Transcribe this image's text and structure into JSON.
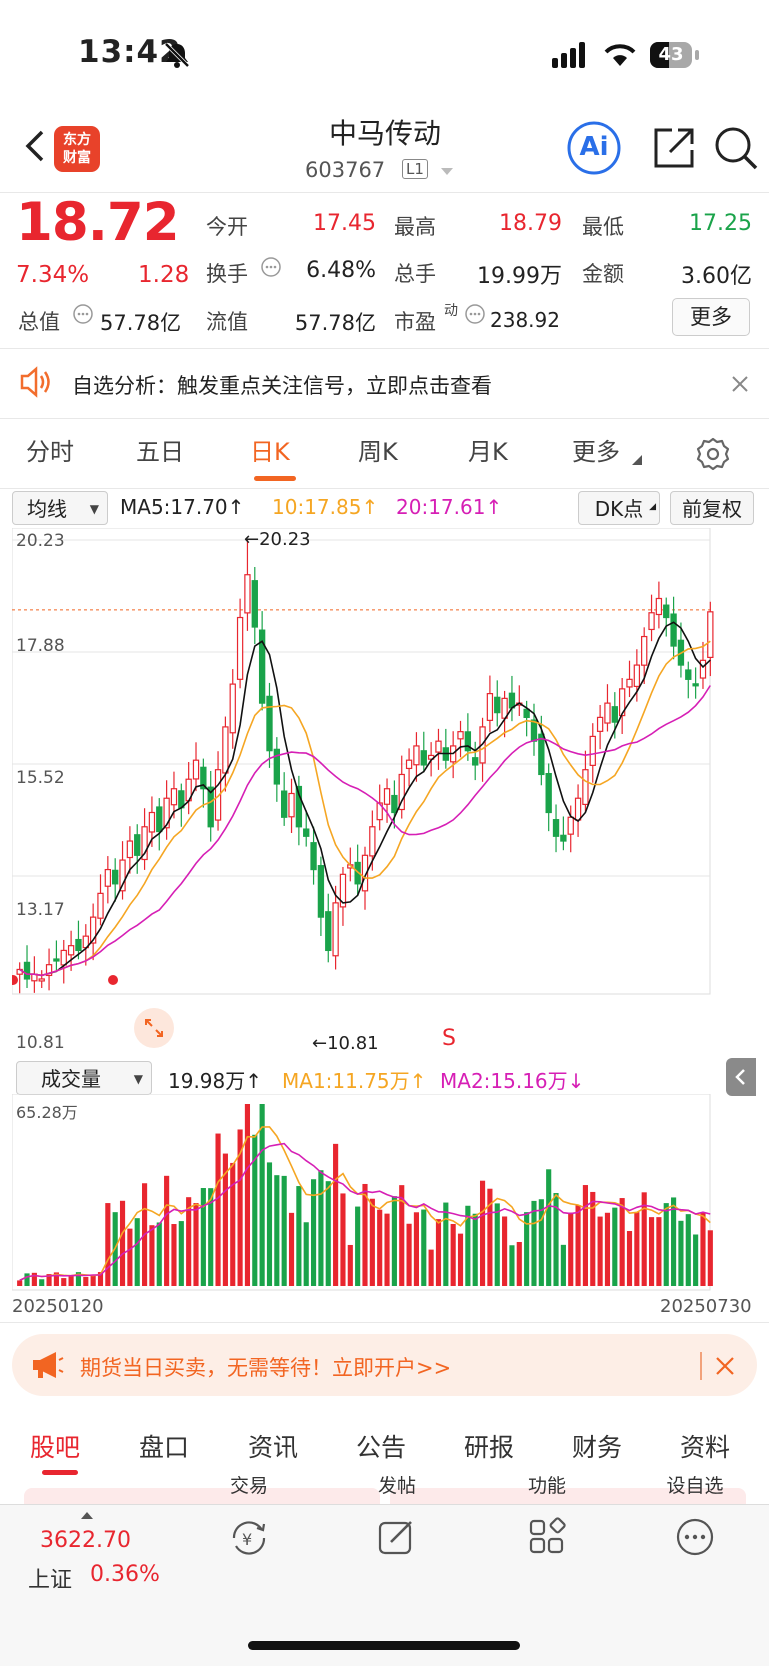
{
  "status_bar": {
    "time": "13:42",
    "battery": "43"
  },
  "header": {
    "name": "中马传动",
    "code": "603767",
    "level": "L1",
    "logo_line1": "东方",
    "logo_line2": "财富",
    "ai_label": "Ai"
  },
  "quote": {
    "price": "18.72",
    "change_pct": "7.34%",
    "change": "1.28",
    "open_label": "今开",
    "open": "17.45",
    "high_label": "最高",
    "high": "18.79",
    "low_label": "最低",
    "low": "17.25",
    "turnover_label": "换手",
    "turnover": "6.48%",
    "volume_label": "总手",
    "volume": "19.99万",
    "amount_label": "金额",
    "amount": "3.60亿",
    "mktcap_label": "总值",
    "mktcap": "57.78亿",
    "float_label": "流值",
    "float_cap": "57.78亿",
    "pe_label": "市盈",
    "pe_sup": "动",
    "pe": "238.92",
    "more_label": "更多"
  },
  "alert": {
    "text": "自选分析：触发重点关注信号，立即点击查看"
  },
  "period_tabs": [
    "分时",
    "五日",
    "日K",
    "周K",
    "月K",
    "更多"
  ],
  "active_period": "日K",
  "chart_toolbar": {
    "indicator": "均线",
    "ma5": "MA5:17.70",
    "ma10": "10:17.85",
    "ma20": "20:17.61",
    "dk": "DK点",
    "adjust": "前复权",
    "volume_indicator": "成交量",
    "vol_value": "19.98万",
    "vol_ma1": "MA1:11.75万",
    "vol_ma2": "MA2:15.16万"
  },
  "price_axis": {
    "ticks": [
      "20.23",
      "17.88",
      "15.52",
      "13.17",
      "10.81"
    ],
    "high_marker": "20.23",
    "low_marker": "10.81",
    "signal_s": "S"
  },
  "volume_axis": {
    "max": "65.28万",
    "start_date": "20250120",
    "end_date": "20250730"
  },
  "promo": {
    "text": "期货当日买卖，无需等待！立即开户>>"
  },
  "bottom_tabs": [
    "股吧",
    "盘口",
    "资讯",
    "公告",
    "研报",
    "财务",
    "资料"
  ],
  "bottom_nav": {
    "index_value": "3622.70",
    "index_name": "上证",
    "index_pct": "0.36%",
    "items": [
      "交易",
      "发帖",
      "功能",
      "设自选"
    ]
  },
  "chart_data": {
    "type": "candlestick",
    "x_range": [
      "20250120",
      "20250730"
    ],
    "ylim": [
      10.81,
      20.23
    ],
    "high": 20.23,
    "low": 10.81,
    "last_close": 18.72,
    "ma": {
      "MA5": 17.7,
      "MA10": 17.85,
      "MA20": 17.61
    },
    "close_series_approx": [
      11.2,
      11.0,
      11.1,
      11.0,
      11.3,
      11.4,
      11.6,
      11.7,
      11.6,
      11.9,
      12.3,
      12.8,
      13.3,
      13.0,
      13.5,
      13.9,
      13.6,
      14.2,
      14.5,
      14.1,
      14.8,
      15.0,
      14.6,
      15.2,
      15.6,
      15.0,
      14.2,
      15.4,
      16.3,
      17.2,
      18.6,
      19.5,
      18.4,
      16.8,
      15.8,
      15.1,
      14.4,
      14.9,
      14.2,
      14.0,
      13.3,
      12.3,
      11.6,
      12.6,
      13.2,
      13.4,
      13.0,
      13.6,
      14.2,
      14.7,
      15.0,
      14.5,
      15.3,
      15.6,
      15.9,
      15.5,
      15.7,
      16.0,
      15.6,
      15.9,
      16.2,
      15.8,
      15.5,
      16.3,
      17.0,
      16.6,
      16.9,
      16.7,
      16.8,
      16.5,
      16.0,
      15.3,
      14.5,
      14.0,
      13.9,
      14.4,
      14.8,
      15.4,
      16.1,
      16.5,
      16.8,
      16.4,
      17.1,
      17.3,
      17.6,
      18.2,
      18.7,
      19.0,
      18.6,
      18.0,
      17.6,
      17.3,
      17.2,
      17.7,
      18.72
    ],
    "volume_unit": "万",
    "volume_max": 65.28,
    "volume_last": 19.98,
    "volume_ma": {
      "MA1": 11.75,
      "MA2": 15.16
    }
  }
}
